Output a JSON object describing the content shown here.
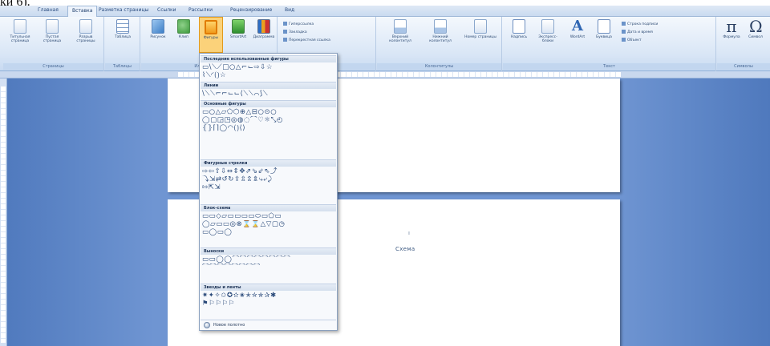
{
  "crop_text": "ки 6).",
  "tabs": [
    {
      "label": "Главная"
    },
    {
      "label": "Вставка"
    },
    {
      "label": "Разметка страницы"
    },
    {
      "label": "Ссылки"
    },
    {
      "label": "Рассылки"
    },
    {
      "label": "Рецензирование"
    },
    {
      "label": "Вид"
    }
  ],
  "ribbon": {
    "groups": [
      {
        "label": "Страницы",
        "buttons": [
          "Титульная страница",
          "Пустая страница",
          "Разрыв страницы"
        ]
      },
      {
        "label": "Таблицы",
        "buttons": [
          "Таблица"
        ]
      },
      {
        "label": "Иллюстрации",
        "buttons": [
          "Рисунок",
          "Клип",
          "Фигуры",
          "SmartArt",
          "Диаграмма"
        ]
      },
      {
        "label": "Связи",
        "small": [
          "Гиперссылка",
          "Закладка",
          "Перекрестная ссылка"
        ]
      },
      {
        "label": "Колонтитулы",
        "buttons": [
          "Верхний колонтитул",
          "Нижний колонтитул",
          "Номер страницы"
        ]
      },
      {
        "label": "Текст",
        "buttons": [
          "Надпись",
          "Экспресс-блоки",
          "WordArt",
          "Буквица"
        ],
        "small": [
          "Строка подписи",
          "Дата и время",
          "Объект"
        ]
      },
      {
        "label": "Символы",
        "buttons": [
          "Формула",
          "Символ"
        ]
      }
    ]
  },
  "shapes_menu": {
    "sections": [
      {
        "label": "Последние использованные фигуры",
        "rows": [
          "▭\\⟍⟋□○△⌐⌙⇨⇩☆",
          "⌇⟍◜⟮⟯☆"
        ]
      },
      {
        "label": "Линии",
        "rows": [
          "\\⟍⟍⌐⌐⌙⌙⟨⟍⟍⌒⟆⟍"
        ]
      },
      {
        "label": "Основные фигуры",
        "rows": [
          "▭○△▱⬠⬡⊕△⊟○⊙○",
          "◯▢◲◳◎◍◌⌒♡☼⤡◴",
          "⦃⦄⌈⌉◯◠⟮⟯⟨⟩"
        ]
      },
      {
        "label": "Фигурные стрелки",
        "rows": [
          "⇨⇦⇧⇩⇔⇕✥⇗⇘⇙⇖⤴",
          "⤵⇲⇄↺↻⇪⇫⇬⇭⤷⤶⤸",
          "⇰⇱⇲"
        ]
      },
      {
        "label": "Блок-схема",
        "rows": [
          "▭▭◇▱▭▭▭▭⬭▭⬠▭",
          "◯▱▭▭◎⊗⌛⌛△▽▢◷",
          "▭◯▭◯"
        ]
      },
      {
        "label": "Выноски",
        "rows": [
          "▭▭◯◯⌒⌒⌒⌒⌒⌒⌒⌒",
          "⌒⌒⌒⌒⌒⌒⌒⌒"
        ]
      },
      {
        "label": "Звезды и ленты",
        "rows": [
          "✷✦✧✩✪✫✬✭✮✯✰✱",
          "⚑⚐⚐⚐⚐"
        ]
      }
    ],
    "bottom_label": "Новое полотно"
  },
  "document": {
    "cursor": "ı",
    "text": "Схема"
  },
  "colors": {
    "accent": "#2b579a",
    "ribbon": "#dbe7f6",
    "workspace": "#6f95d2",
    "shapes_button": "#f7b52e"
  }
}
